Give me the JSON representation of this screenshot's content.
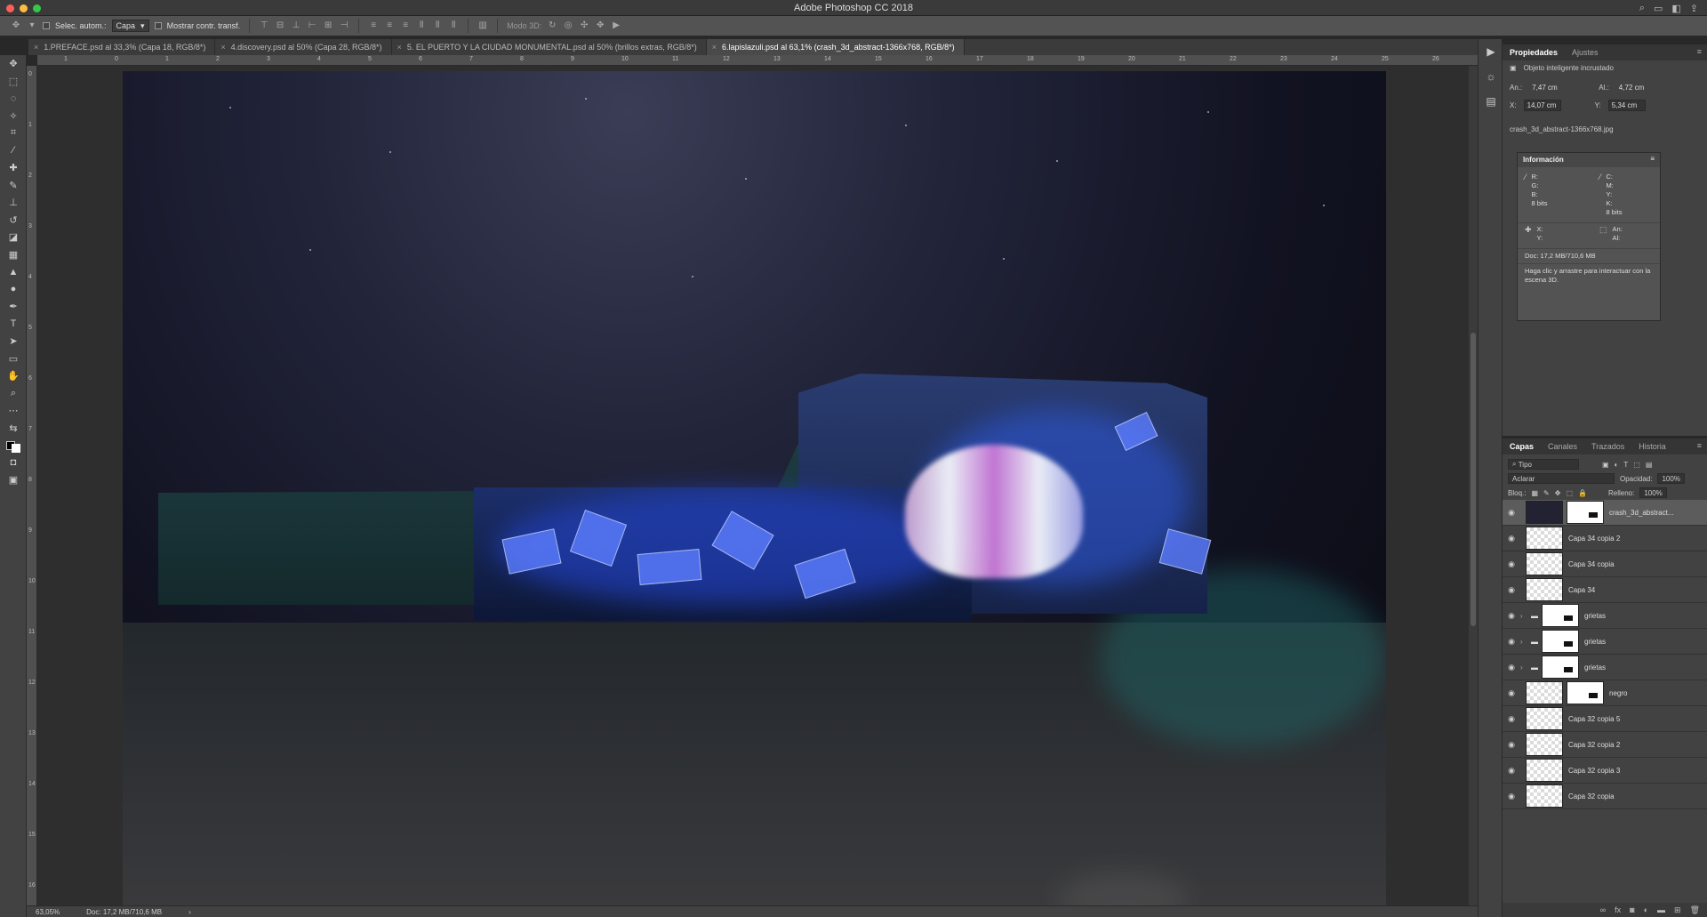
{
  "app": {
    "title": "Adobe Photoshop CC 2018"
  },
  "options_bar": {
    "auto_select_label": "Selec. autom.:",
    "auto_select_value": "Capa",
    "show_transform_label": "Mostrar contr. transf.",
    "mode3d_label": "Modo 3D:"
  },
  "tabs": [
    {
      "label": "1.PREFACE.psd al 33,3% (Capa 18, RGB/8*)"
    },
    {
      "label": "4.discovery.psd al 50% (Capa 28, RGB/8*)"
    },
    {
      "label": "5. EL PUERTO Y LA CIUDAD MONUMENTAL.psd al 50% (brillos extras, RGB/8*)"
    },
    {
      "label": "6.lapislazuli.psd al 63,1% (crash_3d_abstract-1366x768, RGB/8*)"
    }
  ],
  "ruler": {
    "top_ticks": [
      "1",
      "0",
      "1",
      "2",
      "3",
      "4",
      "5",
      "6",
      "7",
      "8",
      "9",
      "10",
      "11",
      "12",
      "13",
      "14",
      "15",
      "16",
      "17",
      "18",
      "19",
      "20",
      "21",
      "22",
      "23",
      "24",
      "25",
      "26"
    ],
    "left_ticks": [
      "0",
      "1",
      "2",
      "3",
      "4",
      "5",
      "6",
      "7",
      "8",
      "9",
      "10",
      "11",
      "12",
      "13",
      "14",
      "15",
      "16"
    ]
  },
  "status": {
    "zoom": "63,05%",
    "doc": "Doc: 17,2 MB/710,6 MB"
  },
  "properties": {
    "tab_properties": "Propiedades",
    "tab_adjustments": "Ajustes",
    "object_type": "Objeto inteligente incrustado",
    "width_label": "An.:",
    "width_value": "7,47 cm",
    "height_label": "Al.:",
    "height_value": "4,72 cm",
    "x_label": "X:",
    "x_value": "14,07 cm",
    "y_label": "Y:",
    "y_value": "5,34 cm",
    "filename": "crash_3d_abstract-1366x768.jpg"
  },
  "info": {
    "title": "Información",
    "rgb": "R:\nG:\nB:",
    "cmyk": "C:\nM:\nY:\nK:",
    "bits1": "8 bits",
    "bits2": "8 bits",
    "xy": "X:\nY:",
    "wh": "An:\nAl:",
    "doc": "Doc: 17,2 MB/710,6 MB",
    "hint": "Haga clic y arrastre para interactuar con la escena 3D."
  },
  "layers_panel": {
    "tabs": [
      "Capas",
      "Canales",
      "Trazados",
      "Historia"
    ],
    "filter": "Tipo",
    "blend_mode": "Aclarar",
    "opacity_label": "Opacidad:",
    "opacity_value": "100%",
    "lock_label": "Bloq.:",
    "fill_label": "Relleno:",
    "fill_value": "100%",
    "layers": [
      {
        "name": "crash_3d_abstract..."
      },
      {
        "name": "Capa 34 copia 2"
      },
      {
        "name": "Capa 34 copia"
      },
      {
        "name": "Capa 34"
      },
      {
        "name": "grietas"
      },
      {
        "name": "grietas"
      },
      {
        "name": "grietas"
      },
      {
        "name": "negro"
      },
      {
        "name": "Capa 32 copia 5"
      },
      {
        "name": "Capa 32 copia 2"
      },
      {
        "name": "Capa 32 copia 3"
      },
      {
        "name": "Capa 32 copia"
      }
    ]
  }
}
